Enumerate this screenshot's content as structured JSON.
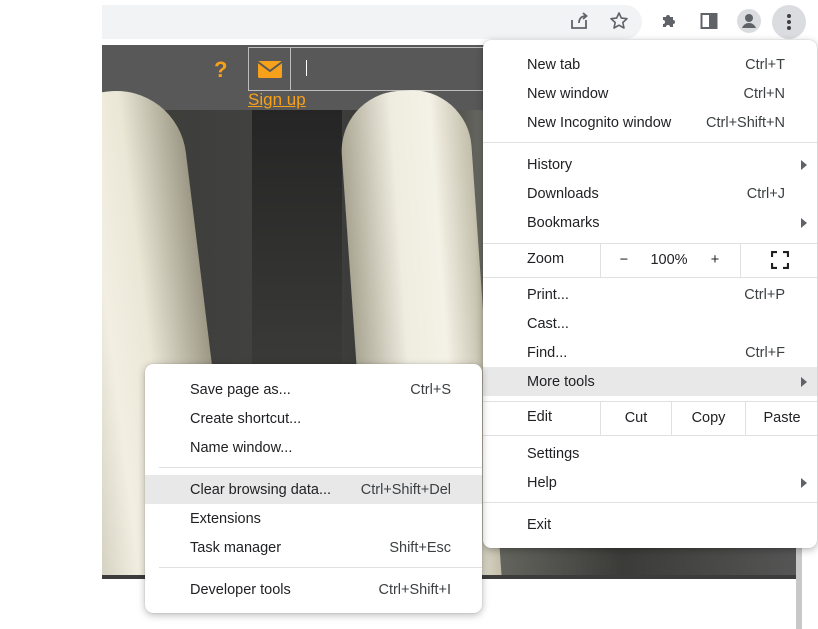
{
  "toolbar": {
    "share_icon": "share-icon",
    "bookmark_icon": "star-icon",
    "extensions_icon": "puzzle-icon",
    "side_panel_icon": "side-panel-icon",
    "profile_icon": "profile-icon",
    "menu_icon": "three-dot-menu-icon"
  },
  "site": {
    "help_glyph": "?",
    "signup_label": "Sign up"
  },
  "main_menu": {
    "new_tab": {
      "label": "New tab",
      "shortcut": "Ctrl+T"
    },
    "new_window": {
      "label": "New window",
      "shortcut": "Ctrl+N"
    },
    "new_incognito": {
      "label": "New Incognito window",
      "shortcut": "Ctrl+Shift+N"
    },
    "history": {
      "label": "History"
    },
    "downloads": {
      "label": "Downloads",
      "shortcut": "Ctrl+J"
    },
    "bookmarks": {
      "label": "Bookmarks"
    },
    "zoom": {
      "label": "Zoom",
      "minus": "−",
      "value": "100%",
      "plus": "+"
    },
    "print": {
      "label": "Print...",
      "shortcut": "Ctrl+P"
    },
    "cast": {
      "label": "Cast..."
    },
    "find": {
      "label": "Find...",
      "shortcut": "Ctrl+F"
    },
    "more_tools": {
      "label": "More tools"
    },
    "edit": {
      "label": "Edit",
      "cut": "Cut",
      "copy": "Copy",
      "paste": "Paste"
    },
    "settings": {
      "label": "Settings"
    },
    "help": {
      "label": "Help"
    },
    "exit": {
      "label": "Exit"
    }
  },
  "more_tools_menu": {
    "save_page": {
      "label": "Save page as...",
      "shortcut": "Ctrl+S"
    },
    "create_shortcut": {
      "label": "Create shortcut..."
    },
    "name_window": {
      "label": "Name window..."
    },
    "clear_data": {
      "label": "Clear browsing data...",
      "shortcut": "Ctrl+Shift+Del"
    },
    "extensions": {
      "label": "Extensions"
    },
    "task_manager": {
      "label": "Task manager",
      "shortcut": "Shift+Esc"
    },
    "developer_tools": {
      "label": "Developer tools",
      "shortcut": "Ctrl+Shift+I"
    }
  }
}
